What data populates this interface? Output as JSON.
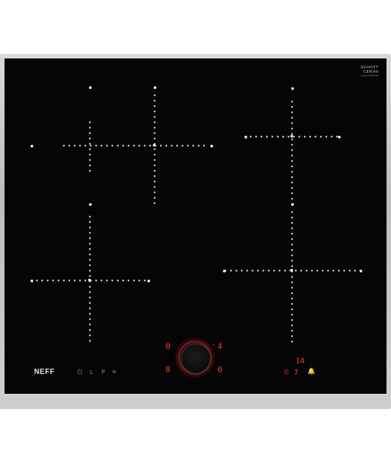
{
  "brand": {
    "line1": "SCHOTT",
    "line2": "CERAN",
    "tagline": "HIGHTRANS",
    "logo": "NEFF"
  },
  "controls": {
    "left_top_digit": "0",
    "left_bottom_digit": "8",
    "right_top_digit": "4",
    "right_bottom_digit": "6",
    "timer_display": "14",
    "timer_symbol": "7",
    "timer_unit": "·",
    "power_icon": "⏻",
    "lock_label": "L",
    "fry_label": "F",
    "menu_label": "≡"
  },
  "icons": [
    "power-icon",
    "lock-icon",
    "bell-icon",
    "timer-icon",
    "control-knob-icon"
  ]
}
